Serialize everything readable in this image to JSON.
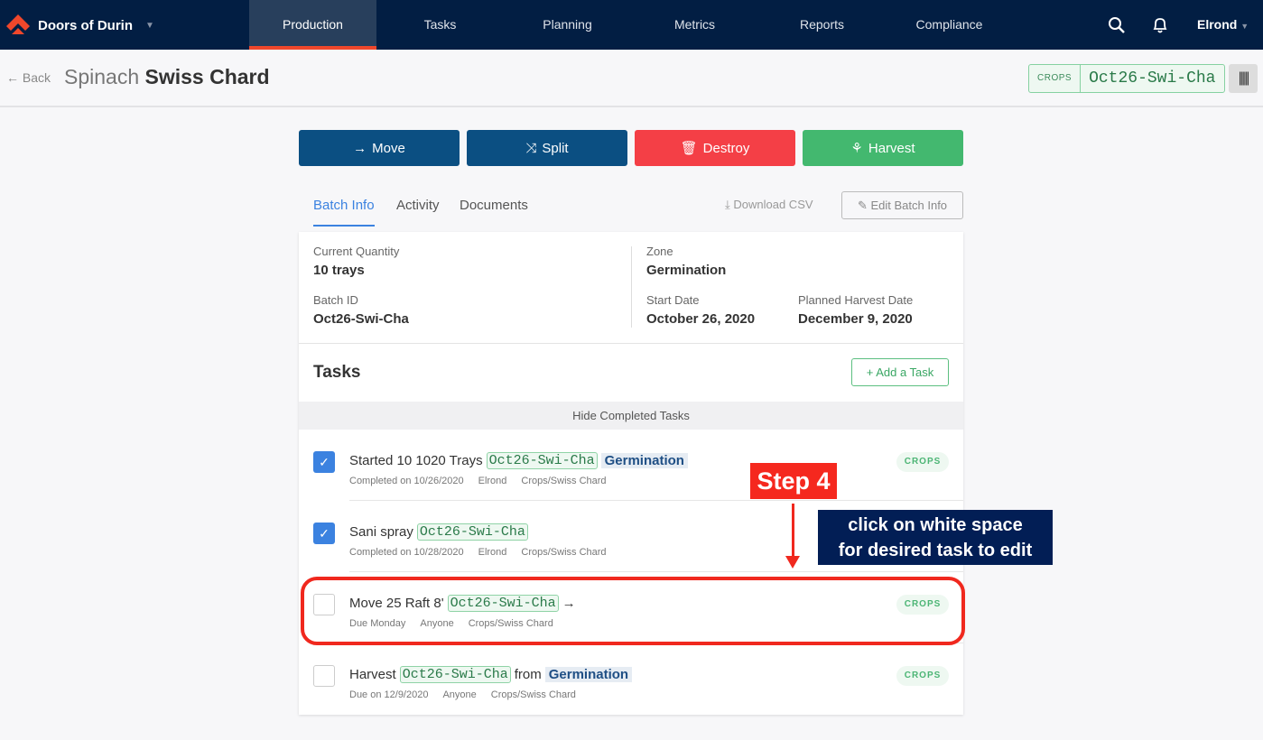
{
  "nav": {
    "brand": "Doors of Durin",
    "tabs": [
      "Production",
      "Tasks",
      "Planning",
      "Metrics",
      "Reports",
      "Compliance"
    ],
    "active_tab": "Production",
    "user": "Elrond",
    "accent": "#f0472b"
  },
  "header": {
    "back": "Back",
    "title_prefix": "Spinach",
    "title_main": "Swiss Chard",
    "tag_key": "CROPS",
    "tag_value": "Oct26-Swi-Cha"
  },
  "actions": {
    "move": "Move",
    "split": "Split",
    "destroy": "Destroy",
    "harvest": "Harvest"
  },
  "tabs": {
    "items": [
      "Batch Info",
      "Activity",
      "Documents"
    ],
    "active": "Batch Info",
    "download": "Download CSV",
    "edit": "Edit Batch Info"
  },
  "info": {
    "qty_label": "Current Quantity",
    "qty": "10 trays",
    "batch_label": "Batch ID",
    "batch": "Oct26-Swi-Cha",
    "zone_label": "Zone",
    "zone": "Germination",
    "start_label": "Start Date",
    "start": "October 26, 2020",
    "harvest_label": "Planned Harvest Date",
    "harvest": "December 9, 2020"
  },
  "tasks": {
    "title": "Tasks",
    "add": "Add a Task",
    "hide": "Hide Completed Tasks",
    "items": [
      {
        "title": "Started 10 1020 Trays",
        "chip": "Oct26-Swi-Cha",
        "suffix": "",
        "zone": "Germination",
        "arrow": "",
        "status": "Completed on 10/26/2020",
        "who": "Elrond",
        "cat": "Crops/Swiss Chard",
        "pill": "CROPS",
        "done": true
      },
      {
        "title": "Sani spray",
        "chip": "Oct26-Swi-Cha",
        "suffix": "",
        "zone": "",
        "arrow": "",
        "status": "Completed on 10/28/2020",
        "who": "Elrond",
        "cat": "Crops/Swiss Chard",
        "pill": "",
        "done": true
      },
      {
        "title": "Move 25 Raft 8'",
        "chip": "Oct26-Swi-Cha",
        "suffix": "",
        "zone": "",
        "arrow": "→",
        "status": "Due Monday",
        "who": "Anyone",
        "cat": "Crops/Swiss Chard",
        "pill": "CROPS",
        "done": false
      },
      {
        "title": "Harvest",
        "chip": "Oct26-Swi-Cha",
        "suffix": "from",
        "zone": "Germination",
        "arrow": "",
        "status": "Due on 12/9/2020",
        "who": "Anyone",
        "cat": "Crops/Swiss Chard",
        "pill": "CROPS",
        "done": false
      }
    ]
  },
  "annotation": {
    "step": "Step 4",
    "note_line1": "click on white space",
    "note_line2": "for desired task to edit"
  }
}
